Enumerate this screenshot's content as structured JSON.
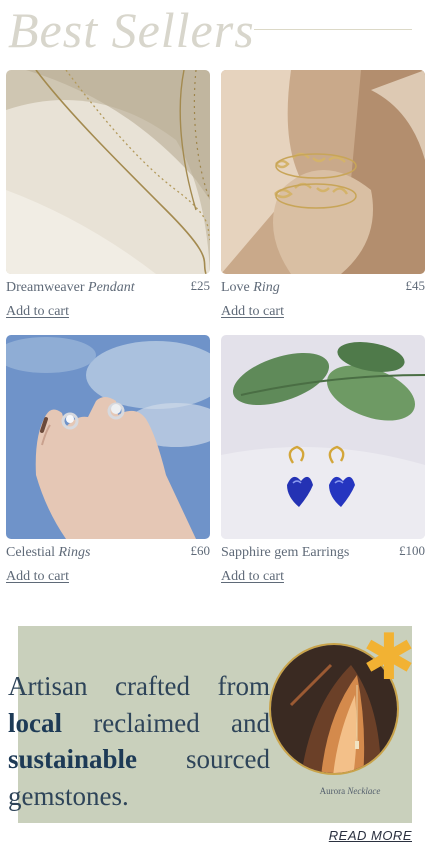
{
  "header": {
    "title": "Best Sellers"
  },
  "products": [
    {
      "name": "Dreamweaver",
      "name_italic": "Pendant",
      "price": "£25",
      "cart_label": "Add to cart"
    },
    {
      "name": "Love",
      "name_italic": "Ring",
      "price": "£45",
      "cart_label": "Add to cart"
    },
    {
      "name": "Celestial",
      "name_italic": "Rings",
      "price": "£60",
      "cart_label": "Add to cart"
    },
    {
      "name": "Sapphire gem Earrings",
      "name_italic": "",
      "price": "£100",
      "cart_label": "Add to cart"
    }
  ],
  "banner": {
    "line1": "Artisan crafted from",
    "bold1": "local",
    "text2": "reclaimed",
    "text3": "and",
    "bold2": "sustainable",
    "text4": "sourced gemstones.",
    "caption": "Aurora",
    "caption_italic": "Necklace",
    "read_more": "READ MORE",
    "accent_color": "#f2b233",
    "background_color": "#c9d0bc"
  }
}
